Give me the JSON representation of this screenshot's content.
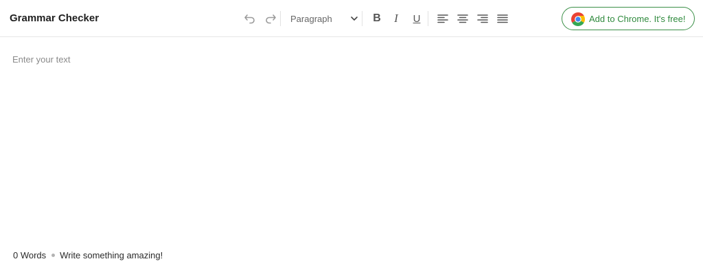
{
  "header": {
    "title": "Grammar Checker",
    "block_format": {
      "selected": "Paragraph"
    },
    "format_buttons": {
      "bold": "B",
      "italic": "I",
      "underline": "U"
    },
    "tools": [
      "undo-icon",
      "redo-icon",
      "bold",
      "italic",
      "underline",
      "align-left-icon",
      "align-center-icon",
      "align-right-icon",
      "align-justify-icon"
    ],
    "extension_button": {
      "label": "Add to Chrome. It's free!",
      "icon": "chrome-logo-icon"
    }
  },
  "editor": {
    "placeholder": "Enter your text"
  },
  "status": {
    "word_count": "0 Words",
    "message": "Write something amazing!"
  },
  "colors": {
    "accent": "#2f8a3d",
    "border": "#3a8f47",
    "placeholder": "#8a8a8a"
  }
}
